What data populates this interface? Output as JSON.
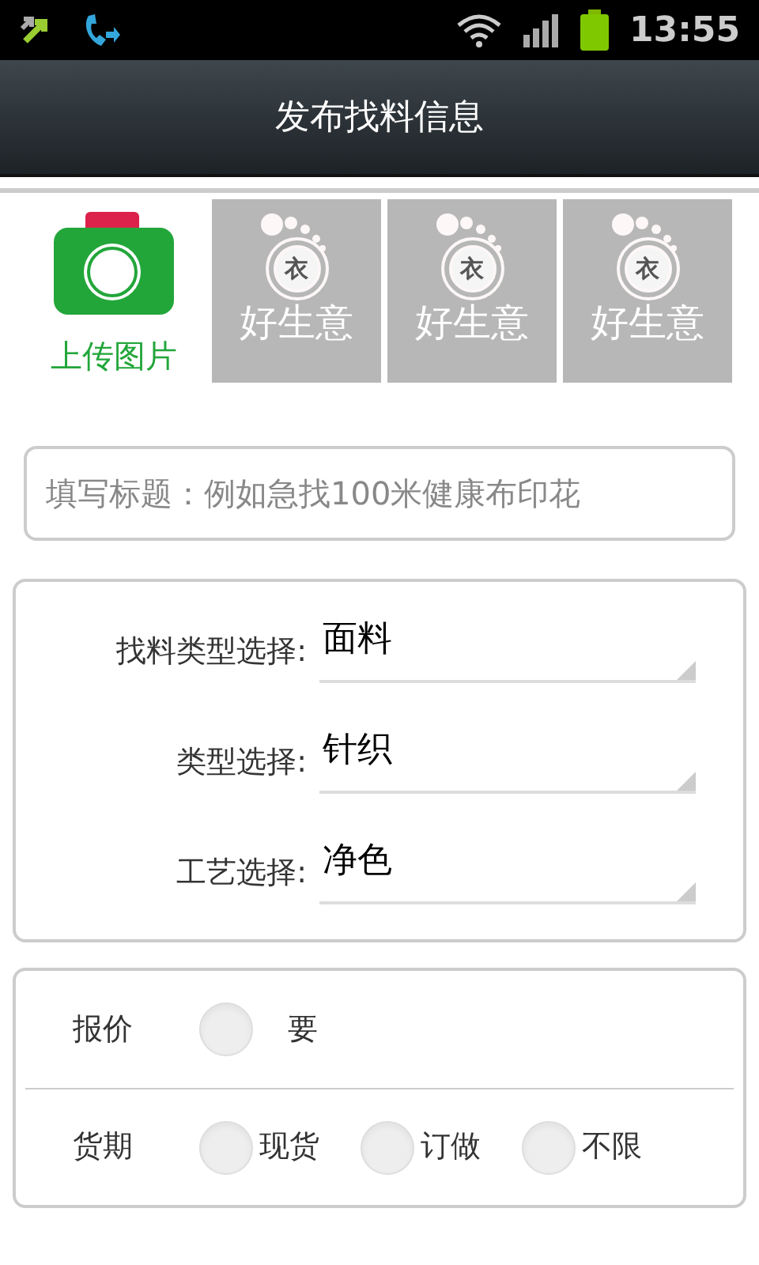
{
  "status_bar": {
    "time": "13:55"
  },
  "title_bar": {
    "title": "发布找料信息"
  },
  "upload": {
    "label": "上传图片"
  },
  "thumbnails": [
    {
      "mark": "衣",
      "label": "好生意"
    },
    {
      "mark": "衣",
      "label": "好生意"
    },
    {
      "mark": "衣",
      "label": "好生意"
    }
  ],
  "title_field": {
    "placeholder": "填写标题：例如急找100米健康布印花"
  },
  "selects": [
    {
      "label": "找料类型选择:",
      "value": "面料"
    },
    {
      "label": "类型选择:",
      "value": "针织"
    },
    {
      "label": "工艺选择:",
      "value": "净色"
    }
  ],
  "options": [
    {
      "label": "报价",
      "choices": [
        {
          "text": "要",
          "checked": false
        }
      ]
    },
    {
      "label": "货期",
      "choices": [
        {
          "text": "现货",
          "checked": false
        },
        {
          "text": "订做",
          "checked": false
        },
        {
          "text": "不限",
          "checked": false
        }
      ]
    }
  ]
}
